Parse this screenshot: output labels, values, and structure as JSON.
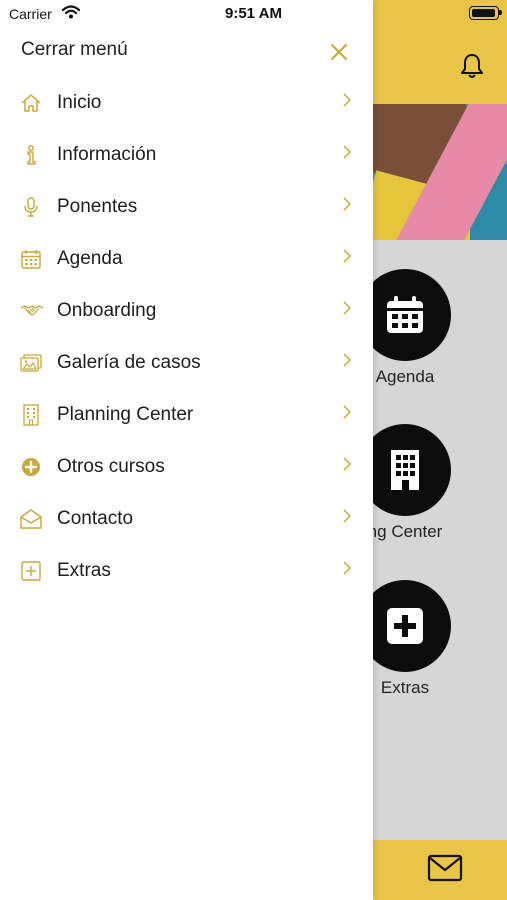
{
  "status_bar": {
    "carrier": "Carrier",
    "time": "9:51 AM"
  },
  "drawer": {
    "close_label": "Cerrar menú",
    "items": [
      {
        "label": "Inicio",
        "icon": "home-icon"
      },
      {
        "label": "Información",
        "icon": "info-icon"
      },
      {
        "label": "Ponentes",
        "icon": "microphone-icon"
      },
      {
        "label": "Agenda",
        "icon": "calendar-icon"
      },
      {
        "label": "Onboarding",
        "icon": "handshake-icon"
      },
      {
        "label": "Galería de casos",
        "icon": "gallery-icon"
      },
      {
        "label": "Planning Center",
        "icon": "building-icon"
      },
      {
        "label": "Otros cursos",
        "icon": "plus-circle-icon"
      },
      {
        "label": "Contacto",
        "icon": "envelope-open-icon"
      },
      {
        "label": "Extras",
        "icon": "plus-square-icon"
      }
    ]
  },
  "background_app": {
    "tiles": [
      {
        "label": "Agenda",
        "icon": "calendar-icon"
      },
      {
        "label": "nning Center",
        "icon": "building-icon"
      },
      {
        "label": "Extras",
        "icon": "plus-square-icon"
      }
    ]
  },
  "colors": {
    "accent": "#e8c547",
    "icon_gold": "#c7a83a",
    "drawer_bg": "#ffffff"
  }
}
